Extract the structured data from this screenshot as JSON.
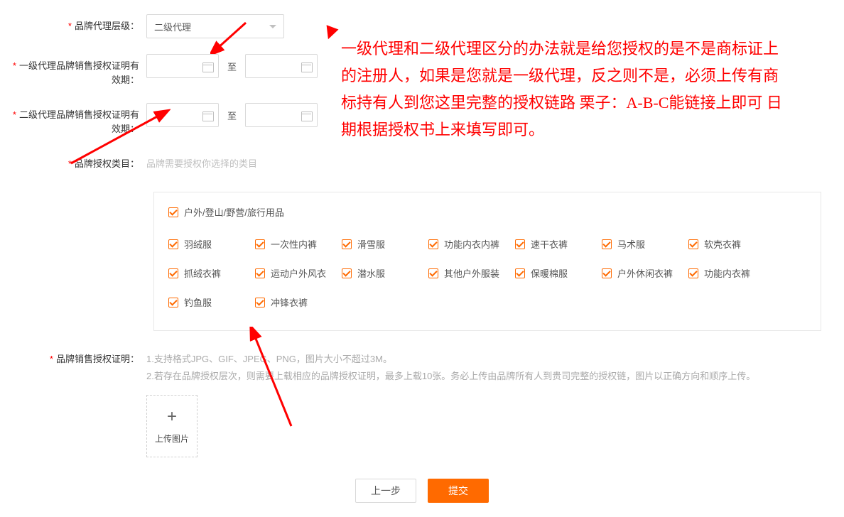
{
  "form": {
    "level": {
      "label": "品牌代理层级：",
      "value": "二级代理"
    },
    "level1_period": {
      "label": "一级代理品牌销售授权证明有效期：",
      "sep": "至"
    },
    "level2_period": {
      "label": "二级代理品牌销售授权证明有效期：",
      "sep": "至"
    },
    "category": {
      "label": "品牌授权类目：",
      "placeholder": "品牌需要授权你选择的类目"
    },
    "proof": {
      "label": "品牌销售授权证明：",
      "help1": "1.支持格式JPG、GIF、JPEG、PNG，图片大小不超过3M。",
      "help2": "2.若存在品牌授权层次，则需要上载相应的品牌授权证明，最多上载10张。务必上传由品牌所有人到贵司完整的授权链，图片以正确方向和顺序上传。",
      "upload_text": "上传图片"
    }
  },
  "categories": {
    "parent": "户外/登山/野营/旅行用品",
    "items": [
      "羽绒服",
      "一次性内裤",
      "滑雪服",
      "功能内衣内裤",
      "速干衣裤",
      "马术服",
      "软壳衣裤",
      "抓绒衣裤",
      "运动户外风衣",
      "潜水服",
      "其他户外服装",
      "保暖棉服",
      "户外休闲衣裤",
      "功能内衣裤",
      "钓鱼服",
      "冲锋衣裤"
    ]
  },
  "buttons": {
    "prev": "上一步",
    "submit": "提交"
  },
  "annotation": "一级代理和二级代理区分的办法就是给您授权的是不是商标证上的注册人，如果是您就是一级代理，反之则不是，必须上传有商标持有人到您这里完整的授权链路 栗子：A-B-C能链接上即可 日期根据授权书上来填写即可。"
}
